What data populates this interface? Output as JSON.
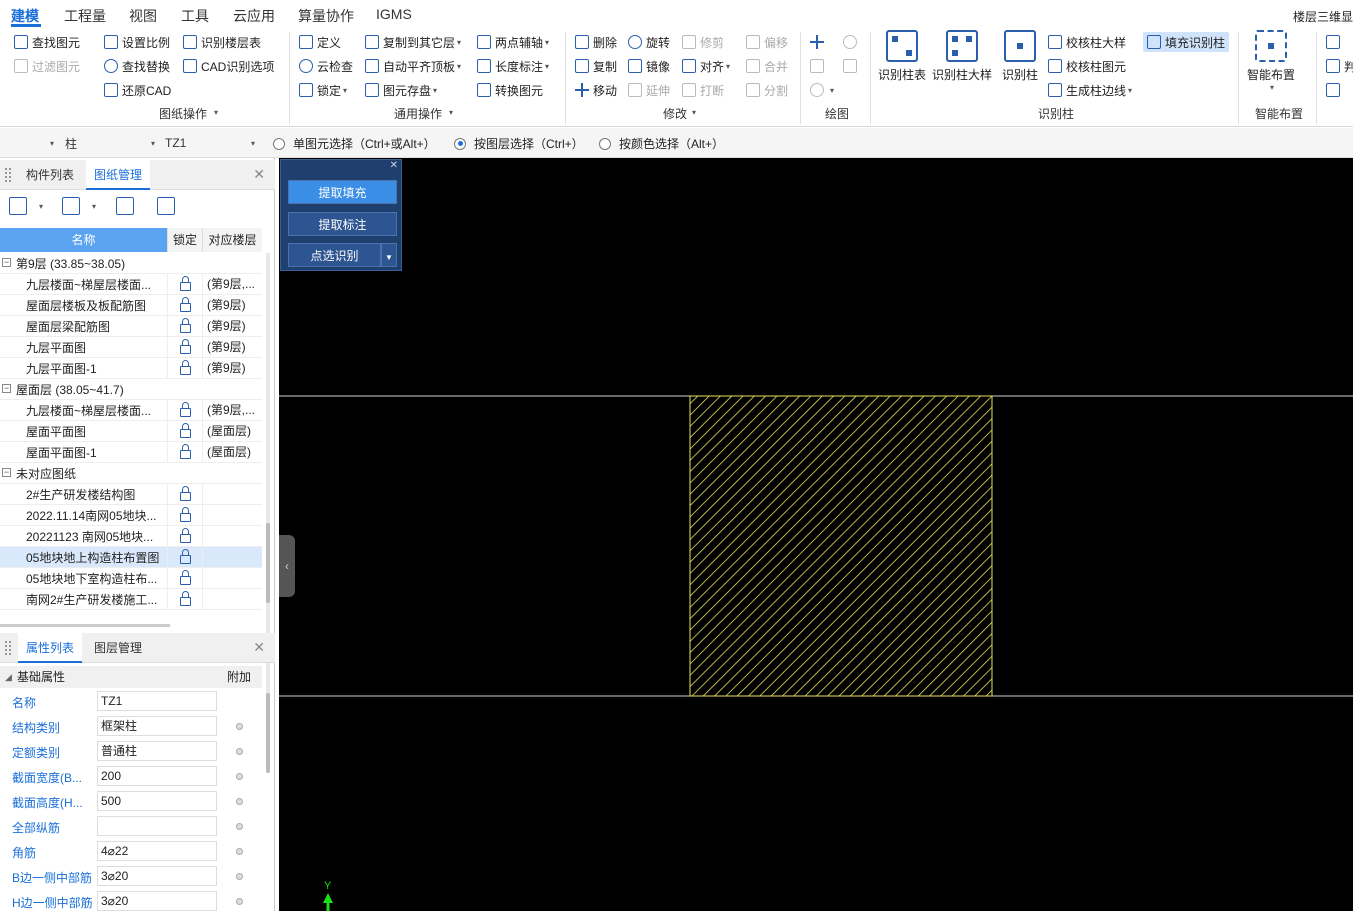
{
  "menu": {
    "tabs": [
      "建模",
      "工程量",
      "视图",
      "工具",
      "云应用",
      "算量协作",
      "IGMS"
    ],
    "right_text": "楼层三维显示"
  },
  "ribbon": {
    "drawing_ops": {
      "label": "图纸操作",
      "items": [
        "查找图元",
        "过滤图元",
        "设置比例",
        "查找替换",
        "还原CAD",
        "识别楼层表",
        "CAD识别选项"
      ]
    },
    "general_ops": {
      "label": "通用操作",
      "items": [
        "定义",
        "云检查",
        "锁定",
        "复制到其它层",
        "自动平齐顶板",
        "图元存盘",
        "两点辅轴",
        "长度标注",
        "转换图元"
      ]
    },
    "modify": {
      "label": "修改",
      "items": [
        "删除",
        "复制",
        "移动",
        "旋转",
        "镜像",
        "延伸",
        "修剪",
        "对齐",
        "打断",
        "偏移",
        "合并",
        "分割"
      ]
    },
    "draw": {
      "label": "绘图"
    },
    "identify_column": {
      "label": "识别柱",
      "big": [
        "识别柱表",
        "识别柱大样",
        "识别柱"
      ],
      "items": [
        "校核柱大样",
        "校核柱图元",
        "生成柱边线",
        "填充识别柱"
      ]
    },
    "smart_layout": {
      "label": "智能布置",
      "big": "智能布置",
      "items": [
        "判",
        "..."
      ]
    }
  },
  "optbar": {
    "combo1": "",
    "combo2": "柱",
    "combo3": "TZ1",
    "radio1": "单图元选择（Ctrl+或Alt+）",
    "radio2": "按图层选择（Ctrl+）",
    "radio3": "按颜色选择（Alt+）",
    "selected": 2
  },
  "left_top": {
    "tabs": [
      "构件列表",
      "图纸管理"
    ],
    "active_tab": 1,
    "columns": [
      "名称",
      "锁定",
      "对应楼层"
    ],
    "tree": [
      {
        "type": "group",
        "name": "第9层 (33.85~38.05)"
      },
      {
        "type": "item",
        "name": "九层楼面~梯屋层楼面...",
        "floor": "(第9层,..."
      },
      {
        "type": "item",
        "name": "屋面层楼板及板配筋图",
        "floor": "(第9层)"
      },
      {
        "type": "item",
        "name": "屋面层梁配筋图",
        "floor": "(第9层)"
      },
      {
        "type": "item",
        "name": "九层平面图",
        "floor": "(第9层)"
      },
      {
        "type": "item",
        "name": "九层平面图-1",
        "floor": "(第9层)"
      },
      {
        "type": "group",
        "name": "屋面层 (38.05~41.7)"
      },
      {
        "type": "item",
        "name": "九层楼面~梯屋层楼面...",
        "floor": "(第9层,..."
      },
      {
        "type": "item",
        "name": "屋面平面图",
        "floor": "(屋面层)"
      },
      {
        "type": "item",
        "name": "屋面平面图-1",
        "floor": "(屋面层)"
      },
      {
        "type": "group",
        "name": "未对应图纸"
      },
      {
        "type": "item",
        "name": "2#生产研发楼结构图",
        "floor": ""
      },
      {
        "type": "item",
        "name": "2022.11.14南网05地块...",
        "floor": ""
      },
      {
        "type": "item",
        "name": "20221123 南网05地块...",
        "floor": ""
      },
      {
        "type": "item",
        "name": "05地块地上构造柱布置图",
        "floor": "",
        "selected": true
      },
      {
        "type": "item",
        "name": "05地块地下室构造柱布...",
        "floor": ""
      },
      {
        "type": "item",
        "name": "南网2#生产研发楼施工...",
        "floor": ""
      }
    ]
  },
  "left_bottom": {
    "tabs": [
      "属性列表",
      "图层管理"
    ],
    "active_tab": 0,
    "section": "基础属性",
    "extra_col": "附加",
    "props": [
      {
        "label": "名称",
        "value": "TZ1",
        "dot": false
      },
      {
        "label": "结构类别",
        "value": "框架柱",
        "dot": true
      },
      {
        "label": "定额类别",
        "value": "普通柱",
        "dot": true
      },
      {
        "label": "截面宽度(B...",
        "value": "200",
        "dot": true
      },
      {
        "label": "截面高度(H...",
        "value": "500",
        "dot": true
      },
      {
        "label": "全部纵筋",
        "value": "",
        "dot": true
      },
      {
        "label": "角筋",
        "value": "4⌀22",
        "dot": true
      },
      {
        "label": "B边一侧中部筋",
        "value": "3⌀20",
        "dot": true
      },
      {
        "label": "H边一侧中部筋",
        "value": "3⌀20",
        "dot": true
      }
    ]
  },
  "fill_panel": {
    "buttons": [
      "提取填充",
      "提取标注",
      "点选识别"
    ]
  },
  "canvas": {
    "axis_label": "Y",
    "line_color": "#cfcfcf",
    "hatch_color": "#e8e05a"
  }
}
